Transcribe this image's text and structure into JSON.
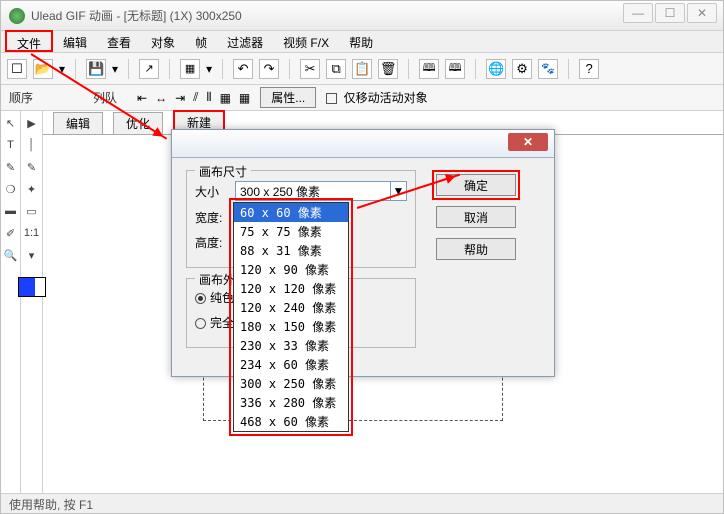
{
  "window": {
    "title": "Ulead GIF 动画 - [无标题] (1X) 300x250"
  },
  "menu": {
    "file": "文件",
    "edit": "编辑",
    "view": "查看",
    "object": "对象",
    "frame": "帧",
    "filter": "过滤器",
    "videofx": "视频 F/X",
    "help": "帮助"
  },
  "toolbar2": {
    "seq": "顺序",
    "queue": "列队",
    "attr": "属性...",
    "onlymove": "仅移动活动对象"
  },
  "tabs": {
    "edit": "编辑",
    "optimize": "优化",
    "new": "新建"
  },
  "dialog": {
    "group_canvas": "画布尺寸",
    "size_label": "大小",
    "size_value": "300 x 250 像素",
    "width_label": "宽度:",
    "height_label": "高度:",
    "group_appearance": "画布外观",
    "radio_pure": "纯色",
    "radio_full": "完全",
    "ok": "确定",
    "cancel": "取消",
    "help": "帮助"
  },
  "dropdown_options": [
    "60 x 60 像素",
    "75 x 75 像素",
    "88 x 31 像素",
    "120 x 90 像素",
    "120 x 120 像素",
    "120 x 240 像素",
    "180 x 150 像素",
    "230 x 33 像素",
    "234 x 60 像素",
    "300 x 250 像素",
    "336 x 280 像素",
    "468 x 60 像素"
  ],
  "statusbar": "使用帮助, 按 F1",
  "icons": {
    "pointer": "↖",
    "play": "▶",
    "text": "T",
    "line": "│",
    "brush": "✎",
    "pen": "✎",
    "eraser": "❍",
    "dropper": "✐",
    "wand": "✦",
    "zoom": "🔍",
    "select": "▭",
    "scale": "1:1",
    "new": "☐",
    "open": "📂",
    "save": "💾",
    "dd": "▾",
    "cut": "✂",
    "copy": "⧉",
    "paste": "📋",
    "del": "🗑",
    "undo": "↶",
    "redo": "↷",
    "ie": "🌐",
    "opt": "⚙",
    "q": "?"
  }
}
